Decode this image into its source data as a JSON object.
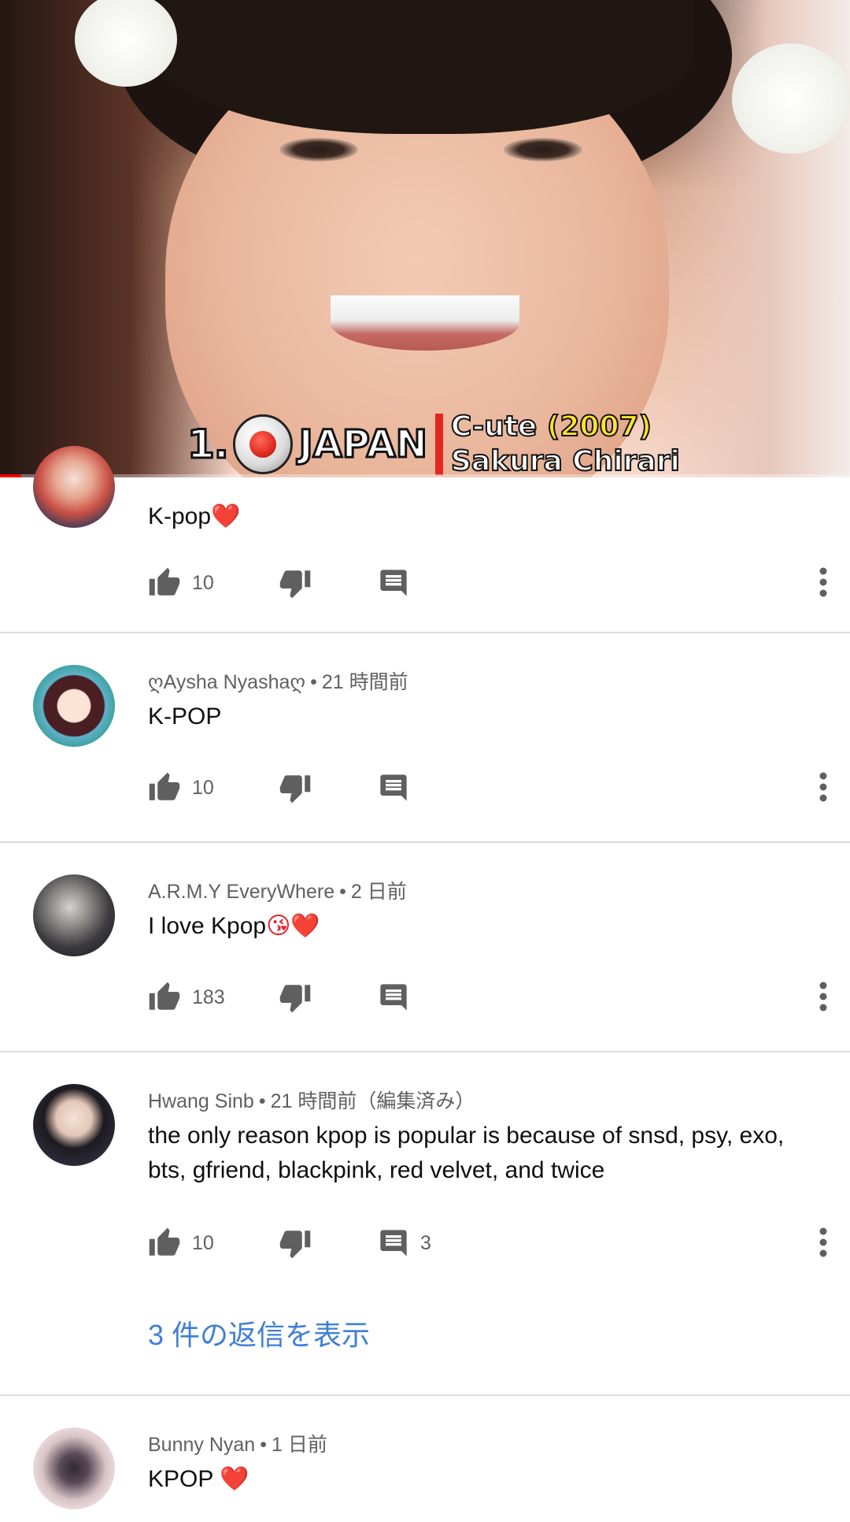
{
  "video": {
    "caption": {
      "rank": "1.",
      "country": "JAPAN",
      "group": "C-ute",
      "year": "(2007)",
      "member": "Sakura Chirari"
    },
    "progress": 0.025
  },
  "comments": [
    {
      "author": "",
      "time": "",
      "text": "K-pop",
      "emoji": "❤️",
      "likes": "10",
      "reply_count": ""
    },
    {
      "author": "ღAysha Nyashaღ",
      "time": "21 時間前",
      "text": "K-POP",
      "likes": "10",
      "reply_count": ""
    },
    {
      "author": "A.R.M.Y EveryWhere",
      "time": "2 日前",
      "text": "I love Kpop",
      "emoji": "😘❤️",
      "likes": "183",
      "reply_count": ""
    },
    {
      "author": "Hwang Sinb",
      "time": "21 時間前（編集済み）",
      "text": "the only reason kpop is popular is because of snsd, psy, exo, bts, gfriend, blackpink, red velvet, and twice",
      "likes": "10",
      "reply_count": "3",
      "view_replies": "3 件の返信を表示"
    },
    {
      "author": "Bunny Nyan",
      "time": "1 日前",
      "text": "KPOP",
      "emoji": "❤️",
      "likes": "",
      "reply_count": ""
    }
  ],
  "icons": {
    "like": "thumb-up-icon",
    "dislike": "thumb-down-icon",
    "reply": "comment-icon",
    "more": "more-vert-icon"
  },
  "colors": {
    "link": "#3e7fd6",
    "meta": "#606060",
    "progress": "#ee0000",
    "heart": "#e3242b"
  }
}
